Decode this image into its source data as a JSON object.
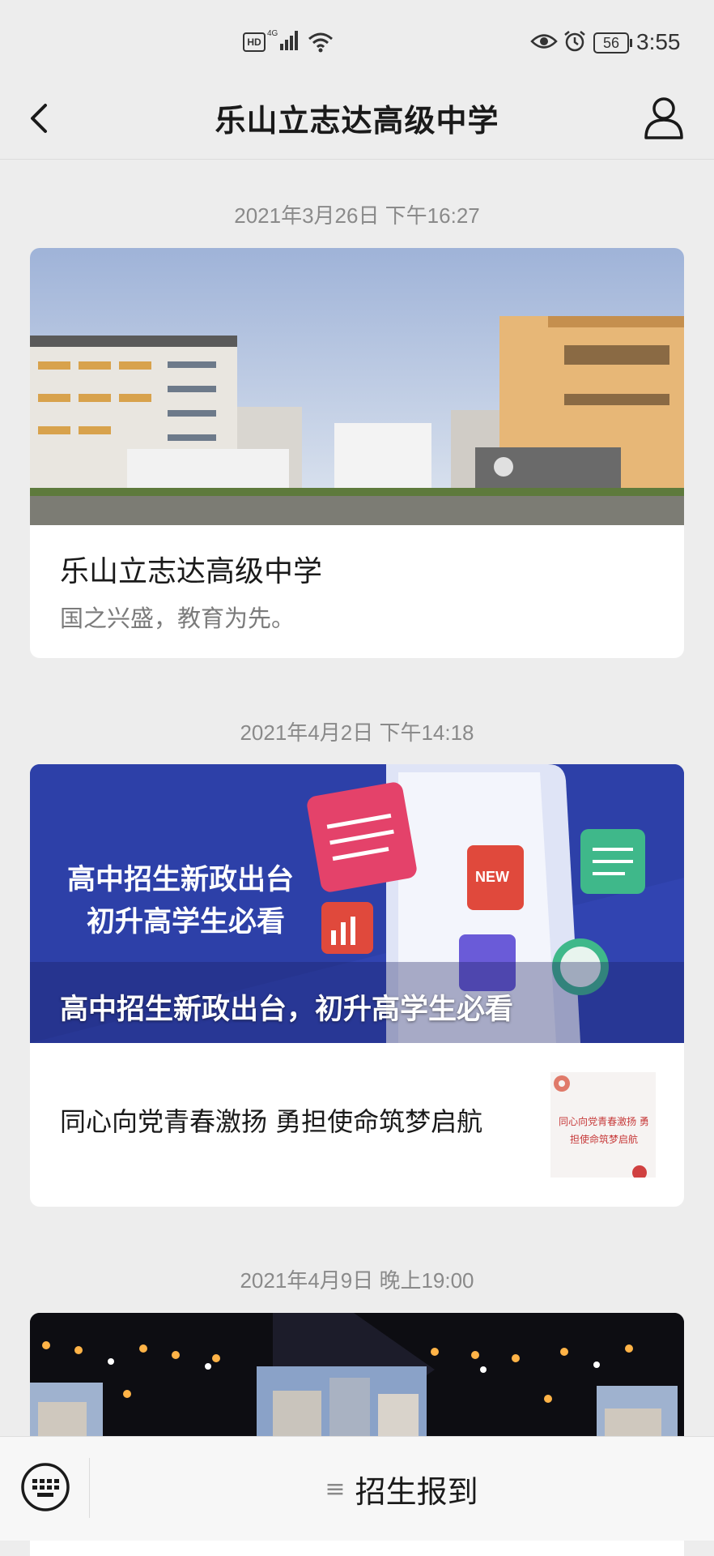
{
  "status_bar": {
    "hd_label": "HD",
    "network_label": "4G",
    "battery_level": "56",
    "time": "3:55",
    "icons": [
      "hd-icon",
      "signal-icon",
      "wifi-icon",
      "eye-icon",
      "alarm-icon",
      "battery-icon"
    ]
  },
  "header": {
    "title": "乐山立志达高级中学",
    "icons": [
      "chevron-left-icon",
      "person-icon"
    ]
  },
  "feed": [
    {
      "timestamp": "2021年3月26日 下午16:27",
      "title": "乐山立志达高级中学",
      "subtitle": "国之兴盛，教育为先。"
    },
    {
      "timestamp": "2021年4月2日 下午14:18",
      "image_text_line1": "高中招生新政出台",
      "image_text_line2": "初升高学生必看",
      "overlay_title": "高中招生新政出台，初升高学生必看",
      "sub_article_title": "同心向党青春激扬 勇担使命筑梦启航",
      "sub_thumb_text": "同心向党青春激扬 勇担使命筑梦启航"
    },
    {
      "timestamp": "2021年4月9日 晚上19:00"
    }
  ],
  "bottom_bar": {
    "menu_label": "招生报到",
    "icons": [
      "keyboard-icon",
      "menu-lines-icon"
    ]
  },
  "colors": {
    "background": "#ededed",
    "policy_banner": "#2b3fa3",
    "timestamp_text": "#8a8a8a"
  }
}
